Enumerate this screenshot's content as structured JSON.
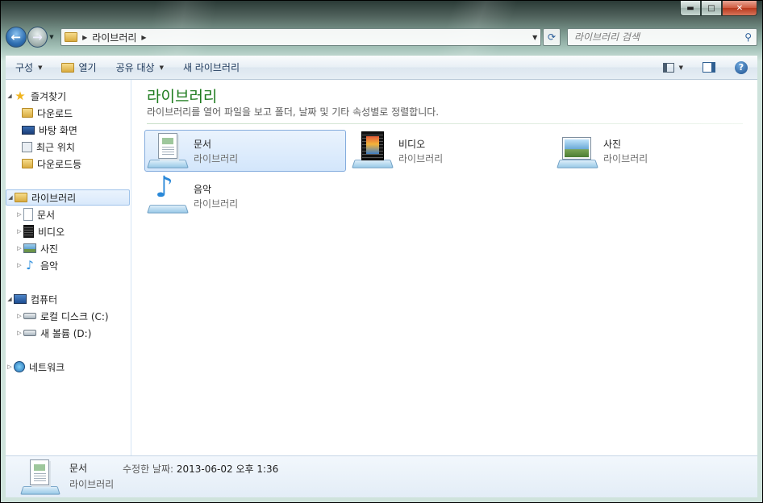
{
  "window": {
    "minimize": "▬",
    "maximize": "□",
    "close": "✕"
  },
  "navbar": {
    "back_icon": "back-arrow",
    "forward_icon": "forward-arrow",
    "address_crumb": "라이브러리",
    "search_placeholder": "라이브러리 검색"
  },
  "toolbar": {
    "organize": "구성",
    "open": "열기",
    "share": "공유 대상",
    "new_library": "새 라이브러리"
  },
  "nav_pane": {
    "favorites": {
      "label": "즐겨찾기",
      "items": [
        {
          "label": "다운로드",
          "icon": "download-folder-icon"
        },
        {
          "label": "바탕 화면",
          "icon": "desktop-icon"
        },
        {
          "label": "최근 위치",
          "icon": "recent-places-icon"
        },
        {
          "label": "다운로드등",
          "icon": "folder-icon"
        }
      ]
    },
    "libraries": {
      "label": "라이브러리",
      "items": [
        {
          "label": "문서"
        },
        {
          "label": "비디오"
        },
        {
          "label": "사진"
        },
        {
          "label": "음악"
        }
      ]
    },
    "computer": {
      "label": "컴퓨터",
      "items": [
        {
          "label": "로컬 디스크 (C:)"
        },
        {
          "label": "새 볼륨 (D:)"
        }
      ]
    },
    "network": {
      "label": "네트워크"
    }
  },
  "main": {
    "title": "라이브러리",
    "subtitle": "라이브러리를 열어 파일을 보고 폴더, 날짜 및 기타 속성별로 정렬합니다.",
    "tiles": [
      {
        "name": "문서",
        "type": "라이브러리",
        "selected": true
      },
      {
        "name": "비디오",
        "type": "라이브러리",
        "selected": false
      },
      {
        "name": "사진",
        "type": "라이브러리",
        "selected": false
      },
      {
        "name": "음악",
        "type": "라이브러리",
        "selected": false
      }
    ]
  },
  "details": {
    "name": "문서",
    "type": "라이브러리",
    "modified_label": "수정한 날짜:",
    "modified_value": "2013-06-02 오후 1:36"
  },
  "colors": {
    "title_green": "#1e7b1e",
    "selection": "#d3e6fb",
    "toolbar_text": "#1e395b"
  }
}
